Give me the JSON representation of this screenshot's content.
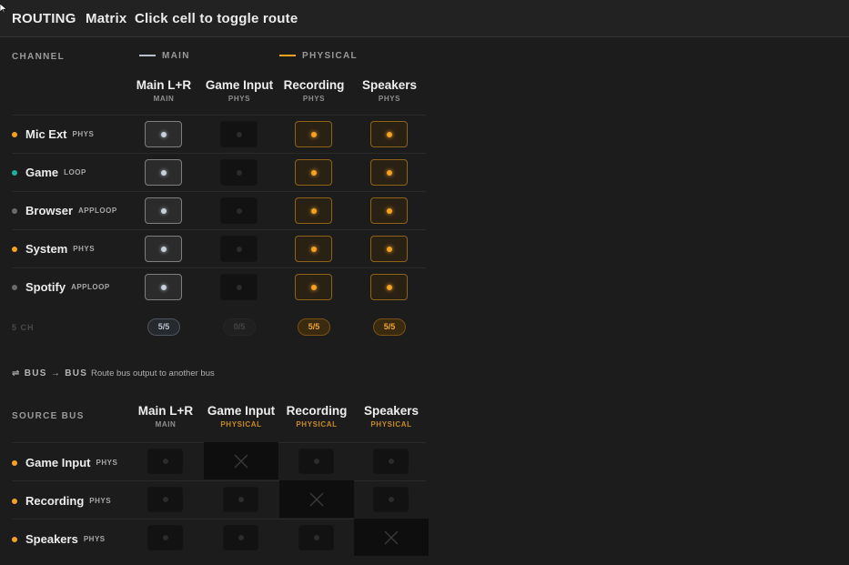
{
  "header": {
    "title": "ROUTING",
    "mode": "Matrix",
    "hint": "Click cell to toggle route"
  },
  "colors": {
    "main": "#b9c1cc",
    "physical": "#f5a21f",
    "loop": "#1ab3a0",
    "apploop": "#6a6a6a"
  },
  "matrix": {
    "channel_label": "CHANNEL",
    "legend": {
      "main": "MAIN",
      "physical": "PHYSICAL"
    },
    "columns": [
      {
        "name": "Main L+R",
        "tag": "MAIN",
        "kind": "main"
      },
      {
        "name": "Game Input",
        "tag": "PHYS",
        "kind": "phys"
      },
      {
        "name": "Recording",
        "tag": "PHYS",
        "kind": "phys"
      },
      {
        "name": "Speakers",
        "tag": "PHYS",
        "kind": "phys"
      }
    ],
    "rows": [
      {
        "name": "Mic Ext",
        "tag": "PHYS",
        "dot": "physical",
        "routes": [
          true,
          false,
          true,
          true
        ]
      },
      {
        "name": "Game",
        "tag": "LOOP",
        "dot": "loop",
        "routes": [
          true,
          false,
          true,
          true
        ]
      },
      {
        "name": "Browser",
        "tag": "APPLOOP",
        "dot": "apploop",
        "routes": [
          true,
          false,
          true,
          true
        ]
      },
      {
        "name": "System",
        "tag": "PHYS",
        "dot": "physical",
        "routes": [
          true,
          false,
          true,
          true
        ]
      },
      {
        "name": "Spotify",
        "tag": "APPLOOP",
        "dot": "apploop",
        "routes": [
          true,
          false,
          true,
          true
        ]
      }
    ],
    "channel_count": "5 CH",
    "totals": [
      "5/5",
      "0/5",
      "5/5",
      "5/5"
    ]
  },
  "bus": {
    "title": "⇌ BUS → BUS",
    "subtitle": "Route bus output to another bus",
    "source_label": "SOURCE BUS",
    "columns": [
      {
        "name": "Main L+R",
        "tag": "MAIN",
        "kind": "main"
      },
      {
        "name": "Game Input",
        "tag": "PHYSICAL",
        "kind": "phys"
      },
      {
        "name": "Recording",
        "tag": "PHYSICAL",
        "kind": "phys"
      },
      {
        "name": "Speakers",
        "tag": "PHYSICAL",
        "kind": "phys"
      }
    ],
    "rows": [
      {
        "name": "Game Input",
        "tag": "PHYS",
        "dot": "physical",
        "routes": [
          false,
          null,
          false,
          false
        ]
      },
      {
        "name": "Recording",
        "tag": "PHYS",
        "dot": "physical",
        "routes": [
          false,
          false,
          null,
          false
        ]
      },
      {
        "name": "Speakers",
        "tag": "PHYS",
        "dot": "physical",
        "routes": [
          false,
          false,
          false,
          null
        ]
      }
    ]
  }
}
